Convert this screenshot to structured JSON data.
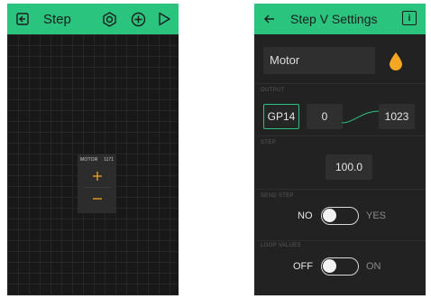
{
  "canvas_screen": {
    "header": {
      "title": "Step",
      "icons": [
        "exit-icon",
        "hexagon-nut-icon",
        "add-circle-icon",
        "play-icon"
      ]
    },
    "widget": {
      "label": "MOTOR",
      "value": "1171",
      "plus_symbol": "+",
      "minus_symbol": "—"
    }
  },
  "settings_screen": {
    "header": {
      "title": "Step V Settings",
      "back_icon": "arrow-left-icon",
      "info_icon": "info-icon",
      "info_symbol": "i"
    },
    "name_field": {
      "value": "Motor"
    },
    "color_drop": {
      "color": "#f5a623"
    },
    "output": {
      "label": "OUTPUT",
      "pin": "GP14",
      "min": "0",
      "max": "1023"
    },
    "step": {
      "label": "STEP",
      "value": "100.0"
    },
    "send_step": {
      "label": "SEND STEP",
      "off_label": "NO",
      "on_label": "YES",
      "state": "off"
    },
    "loop_values": {
      "label": "LOOP VALUES",
      "off_label": "OFF",
      "on_label": "ON",
      "state": "off"
    }
  },
  "colors": {
    "accent": "#2bc47e",
    "widget_accent": "#f5a623",
    "background": "#1b1b1b"
  }
}
